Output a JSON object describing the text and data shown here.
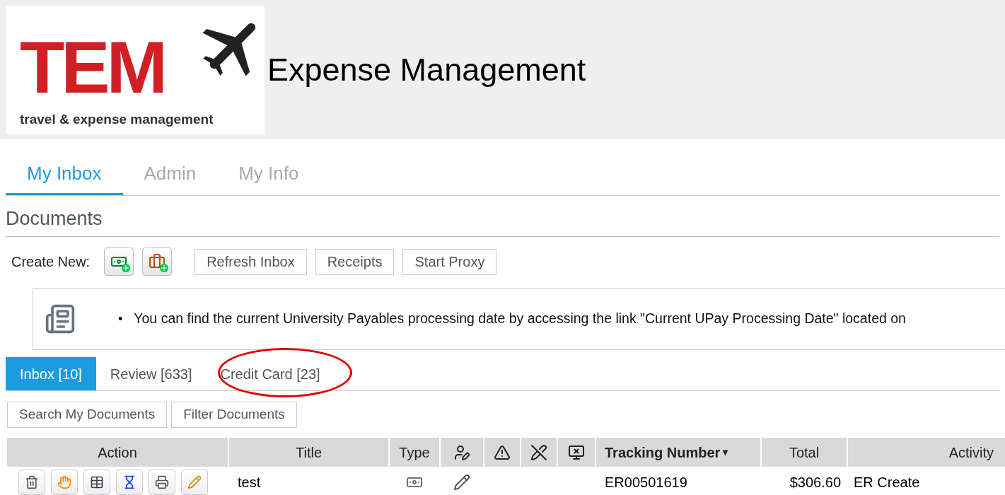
{
  "header": {
    "logo": {
      "letters": "TEM",
      "tagline": "travel & expense management"
    },
    "title": "Expense Management"
  },
  "nav_tabs": [
    {
      "label": "My Inbox",
      "selected": true
    },
    {
      "label": "Admin",
      "selected": false
    },
    {
      "label": "My Info",
      "selected": false
    }
  ],
  "section_title": "Documents",
  "toolbar": {
    "create_new_label": "Create New:",
    "buttons": [
      "Refresh Inbox",
      "Receipts",
      "Start Proxy"
    ]
  },
  "notice": {
    "bullet": "•",
    "text": "You can find the current University Payables processing date by accessing the link \"Current UPay Processing Date\" located on"
  },
  "document_tabs": [
    {
      "label": "Inbox [10]",
      "selected": true
    },
    {
      "label": "Review [633]",
      "selected": false
    },
    {
      "label": "Credit Card [23]",
      "selected": false
    }
  ],
  "search_buttons": [
    "Search My Documents",
    "Filter Documents"
  ],
  "table": {
    "columns": [
      {
        "kind": "text",
        "label": "Action"
      },
      {
        "kind": "text",
        "label": "Title"
      },
      {
        "kind": "text",
        "label": "Type"
      },
      {
        "kind": "icon"
      },
      {
        "kind": "icon"
      },
      {
        "kind": "icon"
      },
      {
        "kind": "icon"
      },
      {
        "kind": "sort",
        "label": "Tracking Number",
        "sort_mark": "▾"
      },
      {
        "kind": "text",
        "label": "Total"
      },
      {
        "kind": "text",
        "label": "Activity"
      }
    ],
    "rows": [
      {
        "title": "test",
        "tracking_number": "ER00501619",
        "total": "$306.60",
        "activity": "ER Create"
      }
    ]
  }
}
